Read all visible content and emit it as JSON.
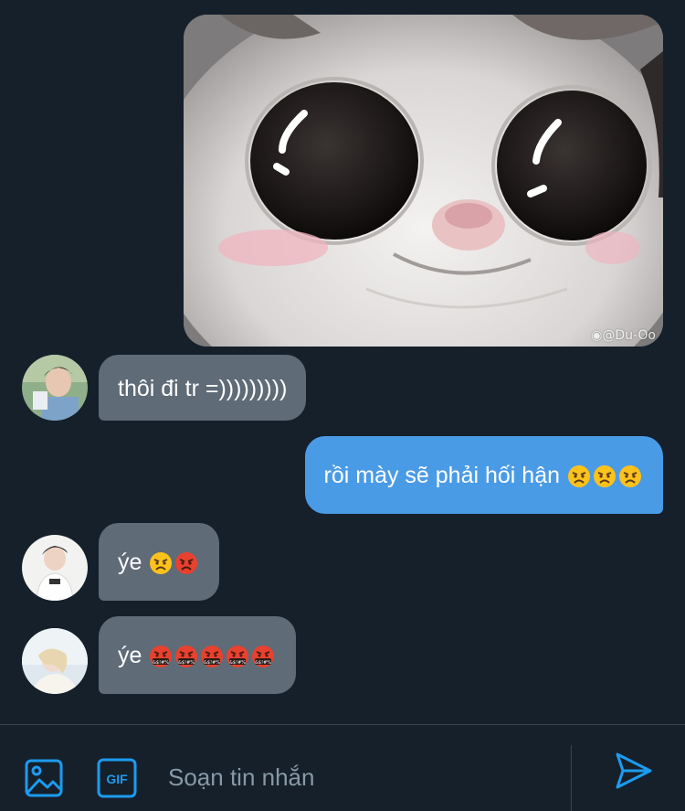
{
  "messages": [
    {
      "type": "image",
      "direction": "outgoing",
      "watermark": "@Du-Oo"
    },
    {
      "type": "text",
      "direction": "incoming",
      "text": "thôi đi tr =)))))))))",
      "emojis": []
    },
    {
      "type": "text",
      "direction": "outgoing",
      "text": "rồi mày sẽ phải hối hận",
      "emojis": [
        "angry-face",
        "angry-face",
        "angry-face"
      ]
    },
    {
      "type": "text",
      "direction": "incoming",
      "text": "ýe",
      "emojis": [
        "angry-face",
        "pouting-face"
      ]
    },
    {
      "type": "text",
      "direction": "incoming",
      "text": "ýe",
      "emojis": [
        "cursing-face",
        "cursing-face",
        "cursing-face",
        "cursing-face",
        "cursing-face"
      ]
    }
  ],
  "composer": {
    "placeholder": "Soạn tin nhắn",
    "gif_label": "GIF",
    "icons": [
      "image-icon",
      "gif-icon",
      "send-icon"
    ]
  },
  "colors": {
    "background": "#15202b",
    "incoming_bubble": "#5f6b77",
    "outgoing_bubble": "#4a9be6",
    "accent": "#1d9bf0",
    "placeholder": "#8899a6"
  }
}
